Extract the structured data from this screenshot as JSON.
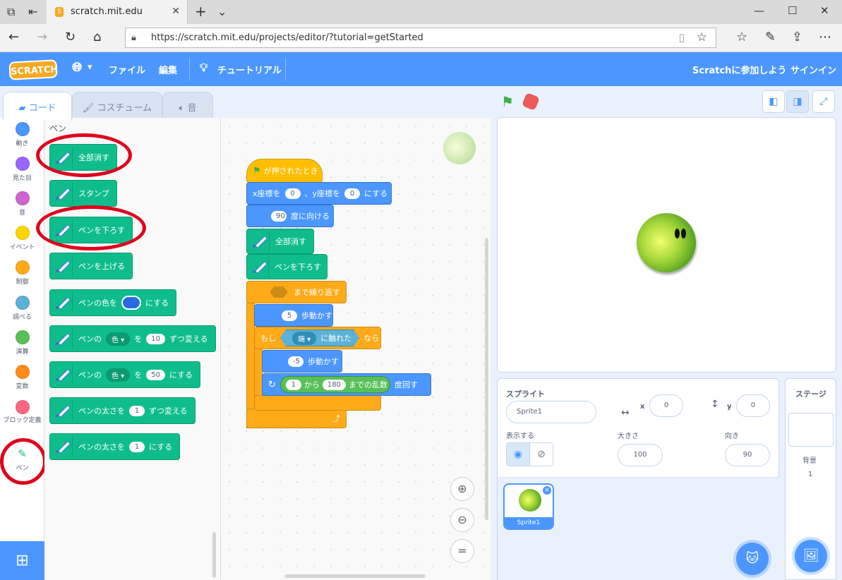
{
  "browser": {
    "tab_title": "scratch.mit.edu",
    "tab_favicon": "S",
    "url": "https://scratch.mit.edu/projects/editor/?tutorial=getStarted"
  },
  "menu": {
    "logo": "SCRATCH",
    "file": "ファイル",
    "edit": "編集",
    "tutorial": "チュートリアル",
    "join": "Scratchに参加しよう",
    "signin": "サインイン"
  },
  "tabs": {
    "code": "コード",
    "costume": "コスチューム",
    "sound": "音"
  },
  "categories": [
    {
      "label": "動き",
      "color": "#4c97ff"
    },
    {
      "label": "見た目",
      "color": "#9966ff"
    },
    {
      "label": "音",
      "color": "#cf63cf"
    },
    {
      "label": "イベント",
      "color": "#ffd500"
    },
    {
      "label": "制御",
      "color": "#ffab19"
    },
    {
      "label": "調べる",
      "color": "#5cb1d6"
    },
    {
      "label": "演算",
      "color": "#59c059"
    },
    {
      "label": "変数",
      "color": "#ff8c1a"
    },
    {
      "label": "ブロック定義",
      "color": "#ff6680"
    },
    {
      "label": "ペン"
    }
  ],
  "palette": {
    "title": "ペン",
    "clear": "全部消す",
    "stamp": "スタンプ",
    "pen_down": "ペンを下ろす",
    "pen_up": "ペンを上げる",
    "set_color_a": "ペンの色を",
    "set_color_b": "にする",
    "change_color_a": "ペンの",
    "change_color_dd": "色",
    "change_color_b": "を",
    "change_color_val": "10",
    "change_color_c": "ずつ変える",
    "set_param_a": "ペンの",
    "set_param_dd": "色",
    "set_param_b": "を",
    "set_param_val": "50",
    "set_param_c": "にする",
    "change_size_a": "ペンの太さを",
    "change_size_val": "1",
    "change_size_b": "ずつ変える",
    "set_size_a": "ペンの太さを",
    "set_size_val": "1",
    "set_size_b": "にする"
  },
  "script": {
    "when_flag": "が押されたとき",
    "goto_a": "x座標を",
    "goto_x": "0",
    "goto_b": "、y座標を",
    "goto_y": "0",
    "goto_c": "にする",
    "point_val": "90",
    "point_b": "度に向ける",
    "clear": "全部消す",
    "pen_down": "ペンを下ろす",
    "repeat_until": "まで繰り返す",
    "move_val": "5",
    "move_b": "歩動かす",
    "if_a": "もし",
    "touch_dd": "端",
    "touch_b": "に触れた",
    "if_b": "なら",
    "move2_val": "-5",
    "move2_b": "歩動かす",
    "turn_from": "1",
    "turn_a": "から",
    "turn_to": "180",
    "turn_b": "までの乱数",
    "turn_c": "度回す"
  },
  "sprite_info": {
    "sprite_label": "スプライト",
    "sprite_name": "Sprite1",
    "x_label": "x",
    "x_val": "0",
    "y_label": "y",
    "y_val": "0",
    "show_label": "表示する",
    "size_label": "大きさ",
    "size_val": "100",
    "direction_label": "向き",
    "direction_val": "90",
    "thumb_name": "Sprite1"
  },
  "stage_panel": {
    "title": "ステージ",
    "backdrop_label": "背景",
    "backdrop_count": "1"
  },
  "colors": {
    "pen_color": "#2b6be0",
    "accent": "#4c97ff"
  }
}
